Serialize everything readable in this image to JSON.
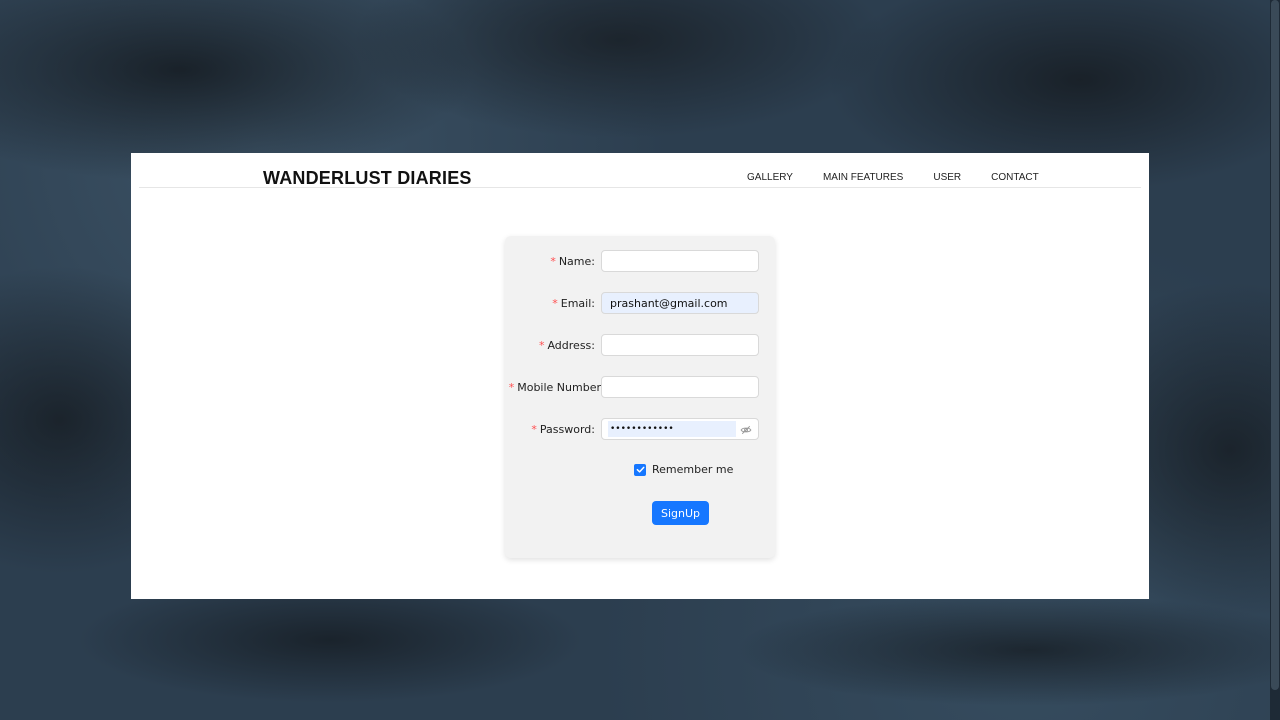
{
  "header": {
    "logo": "WANDERLUST DIARIES",
    "nav": [
      "GALLERY",
      "MAIN FEATURES",
      "USER",
      "CONTACT"
    ]
  },
  "form": {
    "fields": [
      {
        "label": "Name",
        "value": "",
        "required": true
      },
      {
        "label": "Email",
        "value": "prashant@gmail.com",
        "required": true
      },
      {
        "label": "Address",
        "value": "",
        "required": true
      },
      {
        "label": "Mobile Number",
        "value": "",
        "required": true
      },
      {
        "label": "Password",
        "value": "••••••••••••",
        "required": true
      }
    ],
    "required_marker": "*",
    "colon": ":",
    "remember_label": "Remember me",
    "remember_checked": true,
    "submit_label": "SignUp"
  },
  "colors": {
    "primary": "#1677ff",
    "required": "#ff4d4f",
    "autofill": "#e8f0fe",
    "card": "#f2f2f2"
  },
  "icons": {
    "password_toggle": "eye-invisible-icon",
    "checkbox": "check-icon"
  }
}
